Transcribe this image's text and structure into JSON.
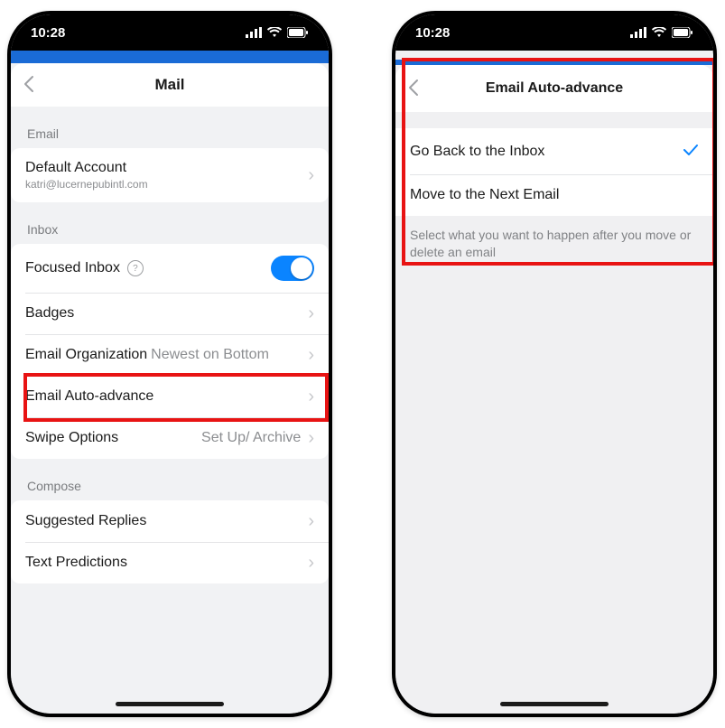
{
  "status": {
    "time": "10:28"
  },
  "leftScreen": {
    "title": "Mail",
    "sections": {
      "email": {
        "header": "Email",
        "defaultAccount": {
          "label": "Default Account",
          "value": "katri@lucernepubintl.com"
        }
      },
      "inbox": {
        "header": "Inbox",
        "focusedInbox": {
          "label": "Focused Inbox",
          "on": true
        },
        "badges": {
          "label": "Badges"
        },
        "emailOrganization": {
          "label": "Email Organization",
          "value": "Newest on Bottom"
        },
        "autoAdvance": {
          "label": "Email Auto-advance"
        },
        "swipeOptions": {
          "label": "Swipe Options",
          "value": "Set Up/ Archive"
        }
      },
      "compose": {
        "header": "Compose",
        "suggestedReplies": {
          "label": "Suggested Replies"
        },
        "textPredictions": {
          "label": "Text Predictions"
        }
      }
    }
  },
  "rightScreen": {
    "title": "Email Auto-advance",
    "options": {
      "goBack": {
        "label": "Go Back to the Inbox",
        "selected": true
      },
      "moveNext": {
        "label": "Move to the Next Email",
        "selected": false
      }
    },
    "footer": "Select what you want to happen after you move or delete an email"
  }
}
